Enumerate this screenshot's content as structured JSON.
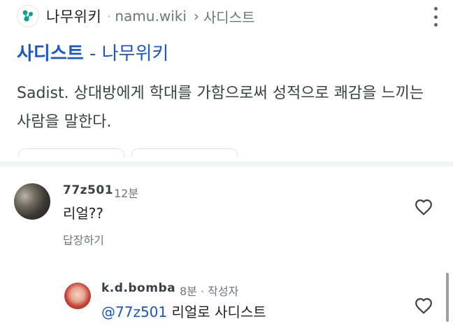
{
  "result": {
    "site_name": "나무위키",
    "separator": "·",
    "url": "namu.wiki",
    "breadcrumb_chevron": "›",
    "breadcrumb": "사디스트",
    "title_main": "사디스트",
    "title_rest": " - 나무위키",
    "snippet": "Sadist. 상대방에게 학대를 가함으로써 성적으로 쾌감을 느끼는 사람을 말한다.",
    "icons": {
      "site_logo": "namu-wiki-logo",
      "more": "more-vert-icon"
    }
  },
  "comments": [
    {
      "author": "77z501",
      "time": "12분",
      "text": "리얼??",
      "reply_label": "답장하기",
      "like_icon": "heart-outline-icon"
    },
    {
      "author": "k.d.bomba",
      "time": "8분 · 작성자",
      "mention": "@77z501",
      "text": " 리얼로 사디스트",
      "like_icon": "heart-outline-icon"
    }
  ],
  "colors": {
    "link": "#1a56cc",
    "logo": "#00a495"
  }
}
